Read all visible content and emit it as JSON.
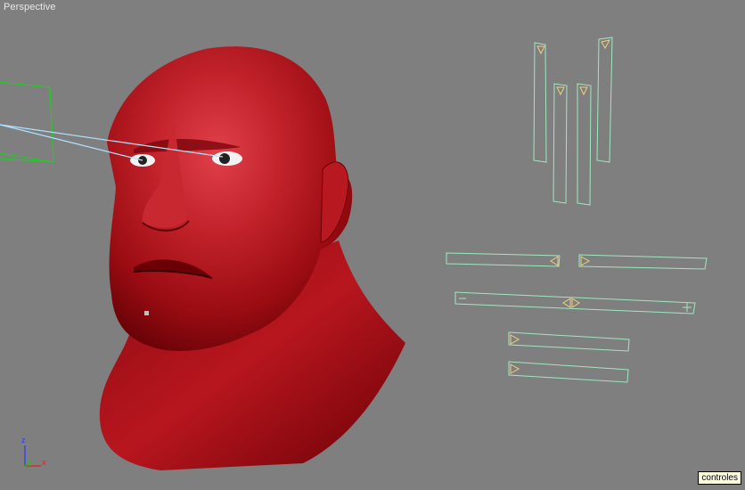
{
  "viewport": {
    "label": "Perspective",
    "background": "#7f7f7f"
  },
  "tooltip": {
    "text": "controles"
  },
  "axis_gizmo": {
    "z": "z",
    "y": "y",
    "x": "x"
  },
  "colors": {
    "control_outline": "#9fe8c0",
    "control_arrow": "#f0d080",
    "camera_frame": "#22cc22",
    "eye_line": "#b0e4ff",
    "skin": "#a80e14"
  },
  "icons": {
    "up_slider_markers": "triangle-down-icon",
    "horizontal_markers": "triangle-right-icon",
    "minus": "minus-icon",
    "plus": "plus-icon"
  }
}
